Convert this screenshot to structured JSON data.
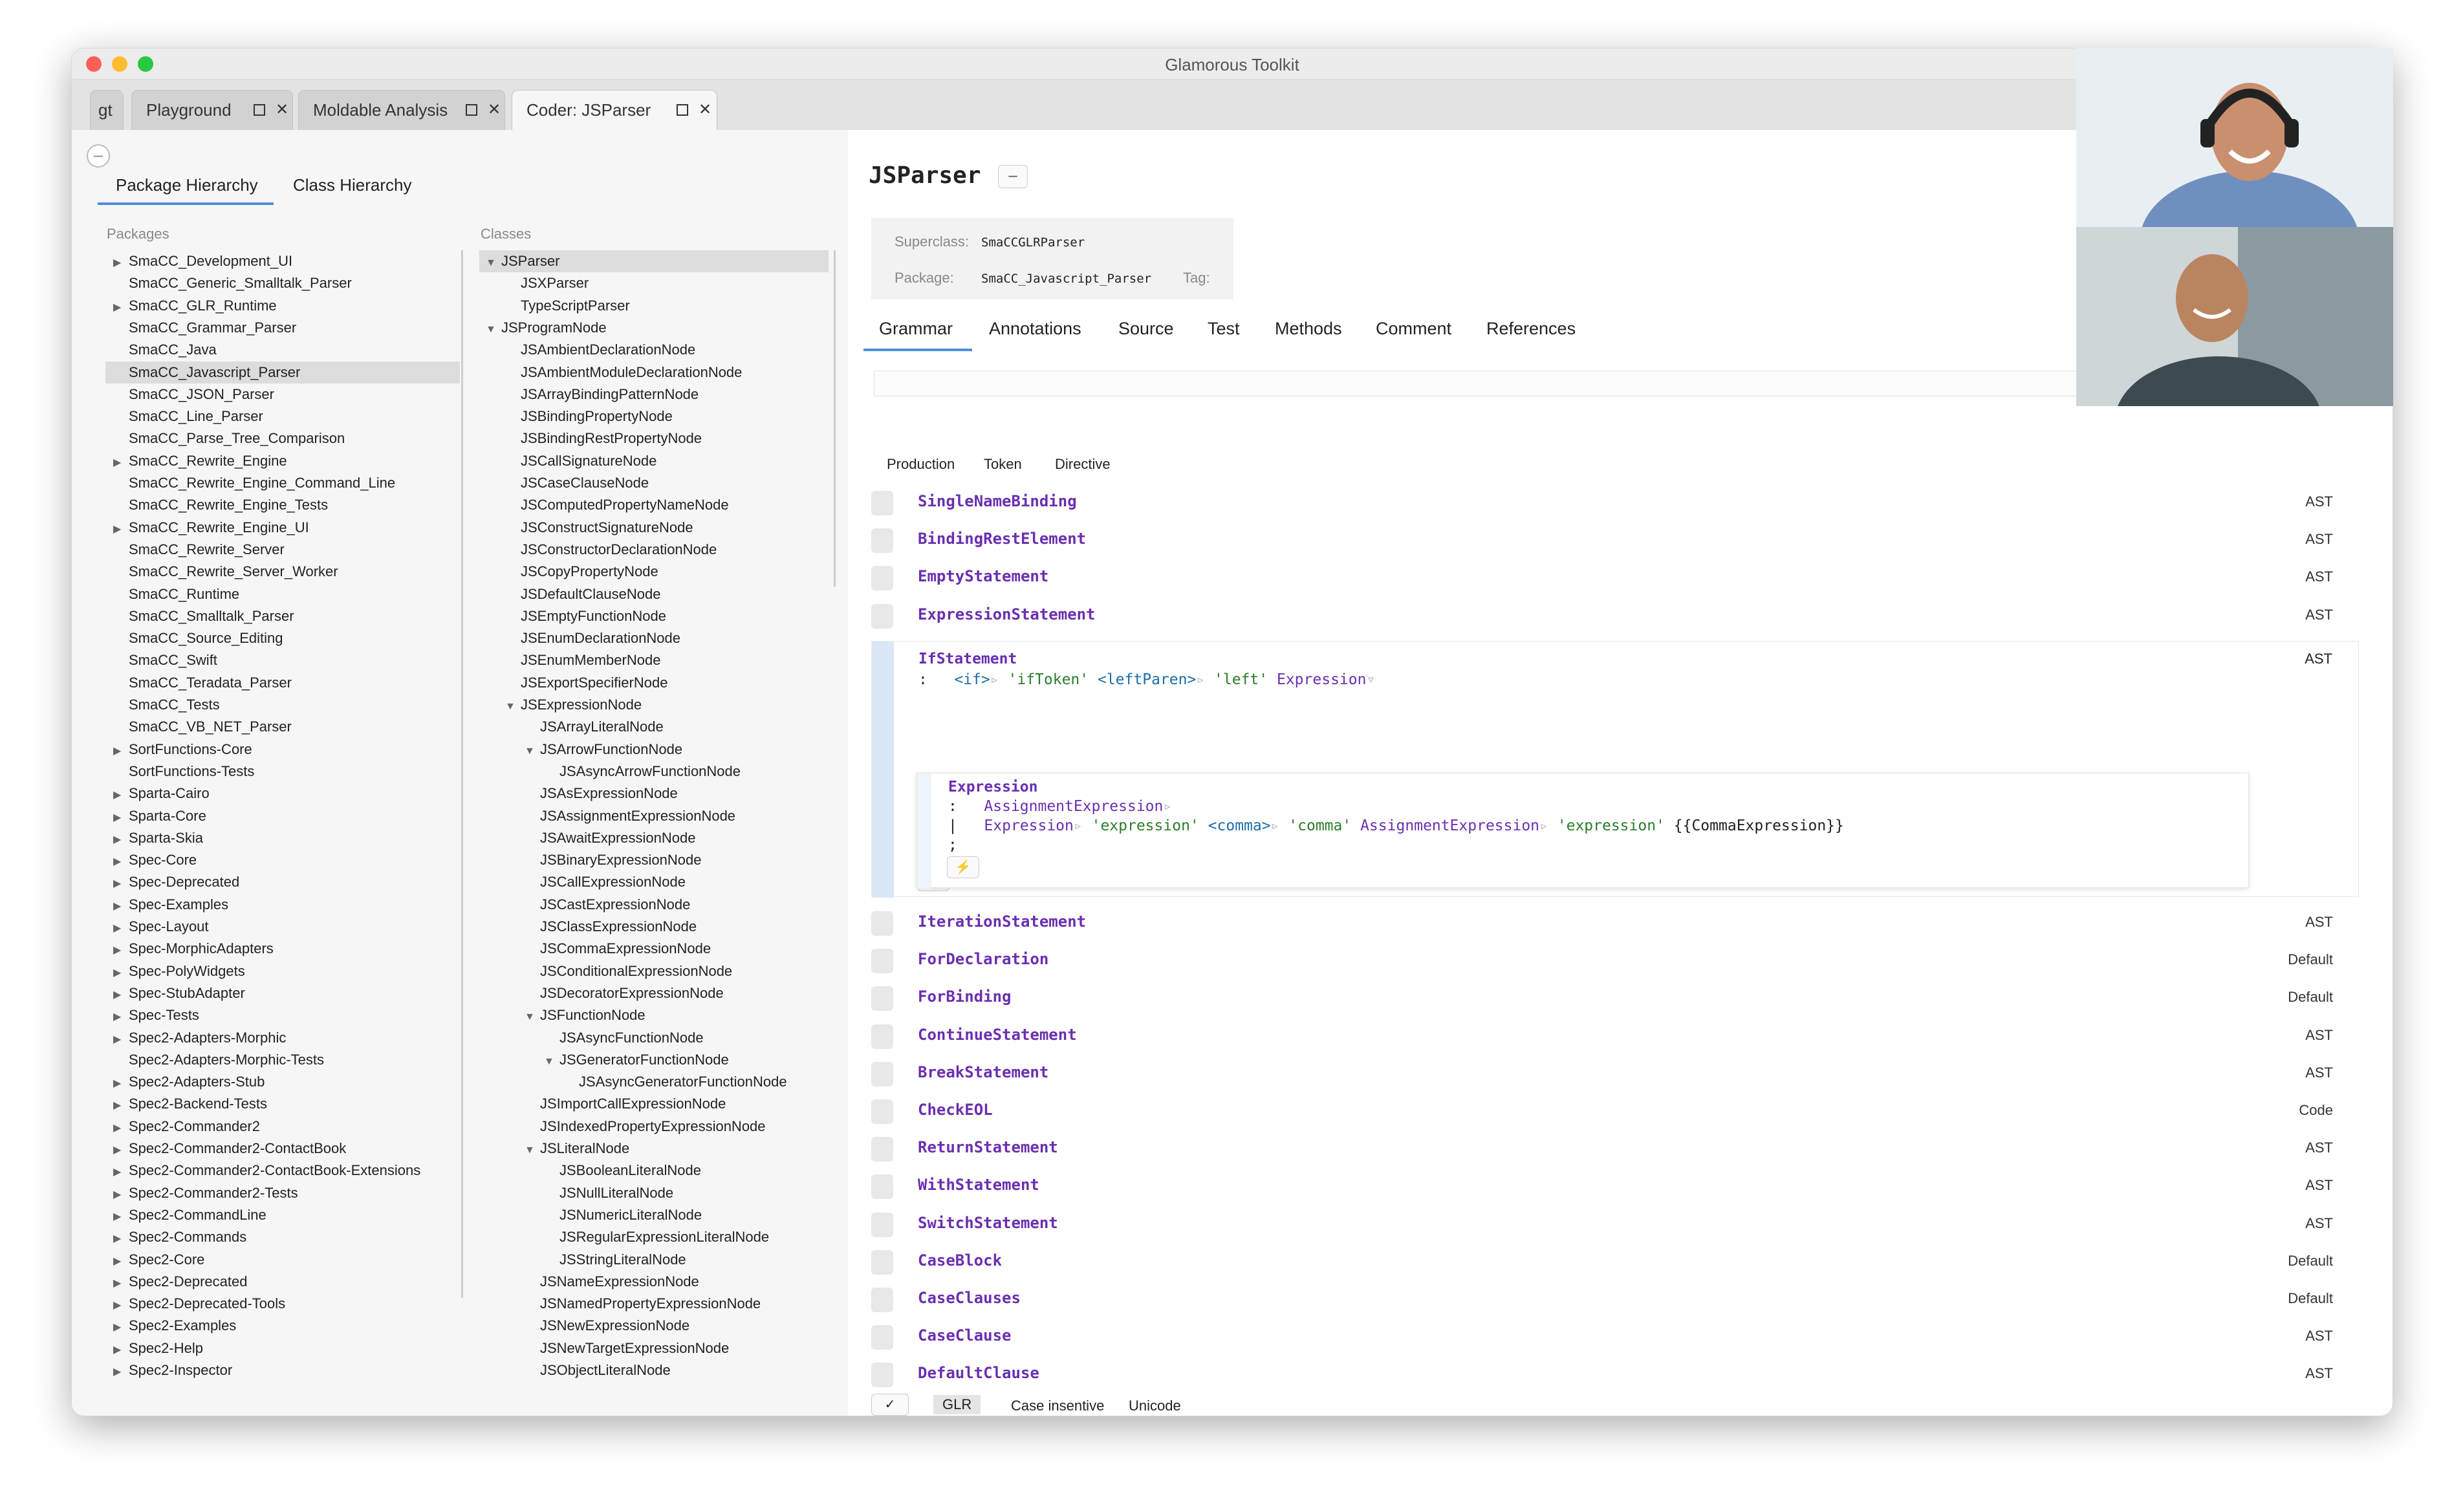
{
  "window": {
    "title": "Glamorous Toolkit"
  },
  "tabs": [
    {
      "label": "gt"
    },
    {
      "label": "Playground"
    },
    {
      "label": "Moldable Analysis"
    },
    {
      "label": "Coder: JSParser"
    }
  ],
  "left": {
    "tabs": [
      {
        "label": "Package Hierarchy"
      },
      {
        "label": "Class Hierarchy"
      }
    ],
    "packages_header": "Packages",
    "classes_header": "Classes",
    "packages": [
      {
        "label": "SmaCC_Development_UI",
        "arrow": "▶"
      },
      {
        "label": "SmaCC_Generic_Smalltalk_Parser",
        "arrow": ""
      },
      {
        "label": "SmaCC_GLR_Runtime",
        "arrow": "▶"
      },
      {
        "label": "SmaCC_Grammar_Parser",
        "arrow": ""
      },
      {
        "label": "SmaCC_Java",
        "arrow": ""
      },
      {
        "label": "SmaCC_Javascript_Parser",
        "arrow": "",
        "selected": true
      },
      {
        "label": "SmaCC_JSON_Parser",
        "arrow": ""
      },
      {
        "label": "SmaCC_Line_Parser",
        "arrow": ""
      },
      {
        "label": "SmaCC_Parse_Tree_Comparison",
        "arrow": ""
      },
      {
        "label": "SmaCC_Rewrite_Engine",
        "arrow": "▶"
      },
      {
        "label": "SmaCC_Rewrite_Engine_Command_Line",
        "arrow": ""
      },
      {
        "label": "SmaCC_Rewrite_Engine_Tests",
        "arrow": ""
      },
      {
        "label": "SmaCC_Rewrite_Engine_UI",
        "arrow": "▶"
      },
      {
        "label": "SmaCC_Rewrite_Server",
        "arrow": ""
      },
      {
        "label": "SmaCC_Rewrite_Server_Worker",
        "arrow": ""
      },
      {
        "label": "SmaCC_Runtime",
        "arrow": ""
      },
      {
        "label": "SmaCC_Smalltalk_Parser",
        "arrow": ""
      },
      {
        "label": "SmaCC_Source_Editing",
        "arrow": ""
      },
      {
        "label": "SmaCC_Swift",
        "arrow": ""
      },
      {
        "label": "SmaCC_Teradata_Parser",
        "arrow": ""
      },
      {
        "label": "SmaCC_Tests",
        "arrow": ""
      },
      {
        "label": "SmaCC_VB_NET_Parser",
        "arrow": ""
      },
      {
        "label": "SortFunctions-Core",
        "arrow": "▶"
      },
      {
        "label": "SortFunctions-Tests",
        "arrow": ""
      },
      {
        "label": "Sparta-Cairo",
        "arrow": "▶"
      },
      {
        "label": "Sparta-Core",
        "arrow": "▶"
      },
      {
        "label": "Sparta-Skia",
        "arrow": "▶"
      },
      {
        "label": "Spec-Core",
        "arrow": "▶"
      },
      {
        "label": "Spec-Deprecated",
        "arrow": "▶"
      },
      {
        "label": "Spec-Examples",
        "arrow": "▶"
      },
      {
        "label": "Spec-Layout",
        "arrow": "▶"
      },
      {
        "label": "Spec-MorphicAdapters",
        "arrow": "▶"
      },
      {
        "label": "Spec-PolyWidgets",
        "arrow": "▶"
      },
      {
        "label": "Spec-StubAdapter",
        "arrow": "▶"
      },
      {
        "label": "Spec-Tests",
        "arrow": "▶"
      },
      {
        "label": "Spec2-Adapters-Morphic",
        "arrow": "▶"
      },
      {
        "label": "Spec2-Adapters-Morphic-Tests",
        "arrow": ""
      },
      {
        "label": "Spec2-Adapters-Stub",
        "arrow": "▶"
      },
      {
        "label": "Spec2-Backend-Tests",
        "arrow": "▶"
      },
      {
        "label": "Spec2-Commander2",
        "arrow": "▶"
      },
      {
        "label": "Spec2-Commander2-ContactBook",
        "arrow": "▶"
      },
      {
        "label": "Spec2-Commander2-ContactBook-Extensions",
        "arrow": "▶"
      },
      {
        "label": "Spec2-Commander2-Tests",
        "arrow": "▶"
      },
      {
        "label": "Spec2-CommandLine",
        "arrow": "▶"
      },
      {
        "label": "Spec2-Commands",
        "arrow": "▶"
      },
      {
        "label": "Spec2-Core",
        "arrow": "▶"
      },
      {
        "label": "Spec2-Deprecated",
        "arrow": "▶"
      },
      {
        "label": "Spec2-Deprecated-Tools",
        "arrow": "▶"
      },
      {
        "label": "Spec2-Examples",
        "arrow": "▶"
      },
      {
        "label": "Spec2-Help",
        "arrow": "▶"
      },
      {
        "label": "Spec2-Inspector",
        "arrow": "▶"
      }
    ],
    "classes": [
      {
        "label": "JSParser",
        "arrow": "▼",
        "indent": 0,
        "selected": true
      },
      {
        "label": "JSXParser",
        "arrow": "",
        "indent": 1
      },
      {
        "label": "TypeScriptParser",
        "arrow": "",
        "indent": 1
      },
      {
        "label": "JSProgramNode",
        "arrow": "▼",
        "indent": 0
      },
      {
        "label": "JSAmbientDeclarationNode",
        "arrow": "",
        "indent": 1
      },
      {
        "label": "JSAmbientModuleDeclarationNode",
        "arrow": "",
        "indent": 1
      },
      {
        "label": "JSArrayBindingPatternNode",
        "arrow": "",
        "indent": 1
      },
      {
        "label": "JSBindingPropertyNode",
        "arrow": "",
        "indent": 1
      },
      {
        "label": "JSBindingRestPropertyNode",
        "arrow": "",
        "indent": 1
      },
      {
        "label": "JSCallSignatureNode",
        "arrow": "",
        "indent": 1
      },
      {
        "label": "JSCaseClauseNode",
        "arrow": "",
        "indent": 1
      },
      {
        "label": "JSComputedPropertyNameNode",
        "arrow": "",
        "indent": 1
      },
      {
        "label": "JSConstructSignatureNode",
        "arrow": "",
        "indent": 1
      },
      {
        "label": "JSConstructorDeclarationNode",
        "arrow": "",
        "indent": 1
      },
      {
        "label": "JSCopyPropertyNode",
        "arrow": "",
        "indent": 1
      },
      {
        "label": "JSDefaultClauseNode",
        "arrow": "",
        "indent": 1
      },
      {
        "label": "JSEmptyFunctionNode",
        "arrow": "",
        "indent": 1
      },
      {
        "label": "JSEnumDeclarationNode",
        "arrow": "",
        "indent": 1
      },
      {
        "label": "JSEnumMemberNode",
        "arrow": "",
        "indent": 1
      },
      {
        "label": "JSExportSpecifierNode",
        "arrow": "",
        "indent": 1
      },
      {
        "label": "JSExpressionNode",
        "arrow": "▼",
        "indent": 1
      },
      {
        "label": "JSArrayLiteralNode",
        "arrow": "",
        "indent": 2
      },
      {
        "label": "JSArrowFunctionNode",
        "arrow": "▼",
        "indent": 2
      },
      {
        "label": "JSAsyncArrowFunctionNode",
        "arrow": "",
        "indent": 3
      },
      {
        "label": "JSAsExpressionNode",
        "arrow": "",
        "indent": 2
      },
      {
        "label": "JSAssignmentExpressionNode",
        "arrow": "",
        "indent": 2
      },
      {
        "label": "JSAwaitExpressionNode",
        "arrow": "",
        "indent": 2
      },
      {
        "label": "JSBinaryExpressionNode",
        "arrow": "",
        "indent": 2
      },
      {
        "label": "JSCallExpressionNode",
        "arrow": "",
        "indent": 2
      },
      {
        "label": "JSCastExpressionNode",
        "arrow": "",
        "indent": 2
      },
      {
        "label": "JSClassExpressionNode",
        "arrow": "",
        "indent": 2
      },
      {
        "label": "JSCommaExpressionNode",
        "arrow": "",
        "indent": 2
      },
      {
        "label": "JSConditionalExpressionNode",
        "arrow": "",
        "indent": 2
      },
      {
        "label": "JSDecoratorExpressionNode",
        "arrow": "",
        "indent": 2
      },
      {
        "label": "JSFunctionNode",
        "arrow": "▼",
        "indent": 2
      },
      {
        "label": "JSAsyncFunctionNode",
        "arrow": "",
        "indent": 3
      },
      {
        "label": "JSGeneratorFunctionNode",
        "arrow": "▼",
        "indent": 3
      },
      {
        "label": "JSAsyncGeneratorFunctionNode",
        "arrow": "",
        "indent": 4
      },
      {
        "label": "JSImportCallExpressionNode",
        "arrow": "",
        "indent": 2
      },
      {
        "label": "JSIndexedPropertyExpressionNode",
        "arrow": "",
        "indent": 2
      },
      {
        "label": "JSLiteralNode",
        "arrow": "▼",
        "indent": 2
      },
      {
        "label": "JSBooleanLiteralNode",
        "arrow": "",
        "indent": 3
      },
      {
        "label": "JSNullLiteralNode",
        "arrow": "",
        "indent": 3
      },
      {
        "label": "JSNumericLiteralNode",
        "arrow": "",
        "indent": 3
      },
      {
        "label": "JSRegularExpressionLiteralNode",
        "arrow": "",
        "indent": 3
      },
      {
        "label": "JSStringLiteralNode",
        "arrow": "",
        "indent": 3
      },
      {
        "label": "JSNameExpressionNode",
        "arrow": "",
        "indent": 2
      },
      {
        "label": "JSNamedPropertyExpressionNode",
        "arrow": "",
        "indent": 2
      },
      {
        "label": "JSNewExpressionNode",
        "arrow": "",
        "indent": 2
      },
      {
        "label": "JSNewTargetExpressionNode",
        "arrow": "",
        "indent": 2
      },
      {
        "label": "JSObjectLiteralNode",
        "arrow": "",
        "indent": 2
      }
    ]
  },
  "right": {
    "class_name": "JSParser",
    "class_button": "–",
    "superclass_label": "Superclass:",
    "superclass": "SmaCCGLRParser",
    "package_label": "Package:",
    "package": "SmaCC_Javascript_Parser",
    "tag_label": "Tag:",
    "tabs": [
      {
        "label": "Grammar"
      },
      {
        "label": "Annotations"
      },
      {
        "label": "Source"
      },
      {
        "label": "Test"
      },
      {
        "label": "Methods"
      },
      {
        "label": "Comment"
      },
      {
        "label": "References"
      }
    ],
    "subtabs": [
      {
        "label": "Production"
      },
      {
        "label": "Token"
      },
      {
        "label": "Directive"
      }
    ],
    "rules_top": [
      {
        "name": "SingleNameBinding",
        "type": "AST"
      },
      {
        "name": "BindingRestElement",
        "type": "AST"
      },
      {
        "name": "EmptyStatement",
        "type": "AST"
      },
      {
        "name": "ExpressionStatement",
        "type": "AST"
      }
    ],
    "expanded": {
      "name": "IfStatement",
      "type": "AST",
      "inner_name": "Expression",
      "button": "⚡"
    },
    "rules_bottom": [
      {
        "name": "IterationStatement",
        "type": "AST"
      },
      {
        "name": "ForDeclaration",
        "type": "Default"
      },
      {
        "name": "ForBinding",
        "type": "Default"
      },
      {
        "name": "ContinueStatement",
        "type": "AST"
      },
      {
        "name": "BreakStatement",
        "type": "AST"
      },
      {
        "name": "CheckEOL",
        "type": "Code"
      },
      {
        "name": "ReturnStatement",
        "type": "AST"
      },
      {
        "name": "WithStatement",
        "type": "AST"
      },
      {
        "name": "SwitchStatement",
        "type": "AST"
      },
      {
        "name": "CaseBlock",
        "type": "Default"
      },
      {
        "name": "CaseClauses",
        "type": "Default"
      },
      {
        "name": "CaseClause",
        "type": "AST"
      },
      {
        "name": "DefaultClause",
        "type": "AST"
      }
    ],
    "bottom": {
      "check": "✓",
      "glr": "GLR",
      "case": "Case insentive",
      "unicode": "Unicode"
    }
  },
  "colors": {
    "accent": "#4a8fd8",
    "rule_name": "#6a2fb0",
    "token": "#1a6fa8",
    "string": "#2b7d2b"
  }
}
